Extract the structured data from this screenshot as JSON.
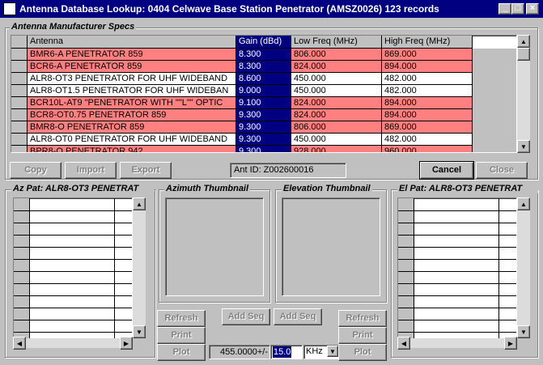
{
  "window": {
    "title": "Antenna Database Lookup: 0404 Celwave Base Station Penetrator (AMSZ0026)  123 records",
    "minimize": "_",
    "maximize": "□",
    "close": "×"
  },
  "specs": {
    "group_title": "Antenna Manufacturer Specs",
    "columns": [
      "Antenna",
      "Gain (dBd)",
      "Low Freq (MHz)",
      "High Freq (MHz)"
    ],
    "rows": [
      {
        "antenna": "BMR6-A PENETRATOR 859",
        "gain": "8.300",
        "low": "806.000",
        "high": "869.000",
        "color": "#ff8080"
      },
      {
        "antenna": "BCR6-A PENETRATOR 859",
        "gain": "8.300",
        "low": "824.000",
        "high": "894.000",
        "color": "#ff8080"
      },
      {
        "antenna": "ALR8-OT3 PENETRATOR FOR UHF WIDEBAND",
        "gain": "8.600",
        "low": "450.000",
        "high": "482.000",
        "color": "#ffffff"
      },
      {
        "antenna": "ALR8-OT1.5 PENETRATOR FOR UHF WIDEBAN",
        "gain": "9.000",
        "low": "450.000",
        "high": "482.000",
        "color": "#ffffff"
      },
      {
        "antenna": "BCR10L-AT9 \"PENETRATOR WITH \"\"L\"\" OPTIC",
        "gain": "9.100",
        "low": "824.000",
        "high": "894.000",
        "color": "#ff8080"
      },
      {
        "antenna": "BCR8-OT0.75 PENETRATOR 859",
        "gain": "9.300",
        "low": "824.000",
        "high": "894.000",
        "color": "#ff8080"
      },
      {
        "antenna": "BMR8-O PENETRATOR 859",
        "gain": "9.300",
        "low": "806.000",
        "high": "869.000",
        "color": "#ff8080"
      },
      {
        "antenna": "ALR8-OT0 PENETRATOR FOR UHF WIDEBAND",
        "gain": "9.300",
        "low": "450.000",
        "high": "482.000",
        "color": "#ffffff"
      },
      {
        "antenna": "BPR8-O PENETRATOR 942",
        "gain": "9.300",
        "low": "928.000",
        "high": "960.000",
        "color": "#ff8080"
      }
    ],
    "selected_color": "#000080"
  },
  "buttons": {
    "copy": "Copy",
    "import": "Import",
    "export": "Export",
    "cancel": "Cancel",
    "close": "Close"
  },
  "ant_id": "Ant ID: Z002600016",
  "az_pat": {
    "title": "Az Pat: ALR8-OT3 PENETRAT"
  },
  "el_pat": {
    "title": "El Pat: ALR8-OT3 PENETRAT"
  },
  "azimuth_thumb": {
    "title": "Azimuth Thumbnail"
  },
  "elevation_thumb": {
    "title": "Elevation Thumbnail"
  },
  "bottom": {
    "refresh_left": "Refresh",
    "print_left": "Print",
    "plot_left": "Plot",
    "add_seq_1": "Add Seq",
    "add_seq_2": "Add Seq",
    "refresh_right": "Refresh",
    "print_right": "Print",
    "plot_right": "Plot",
    "freq_label": "455.0000+/-",
    "bandwidth_value": "15.0",
    "unit": "KHz",
    "unit_arrow": "▼"
  }
}
